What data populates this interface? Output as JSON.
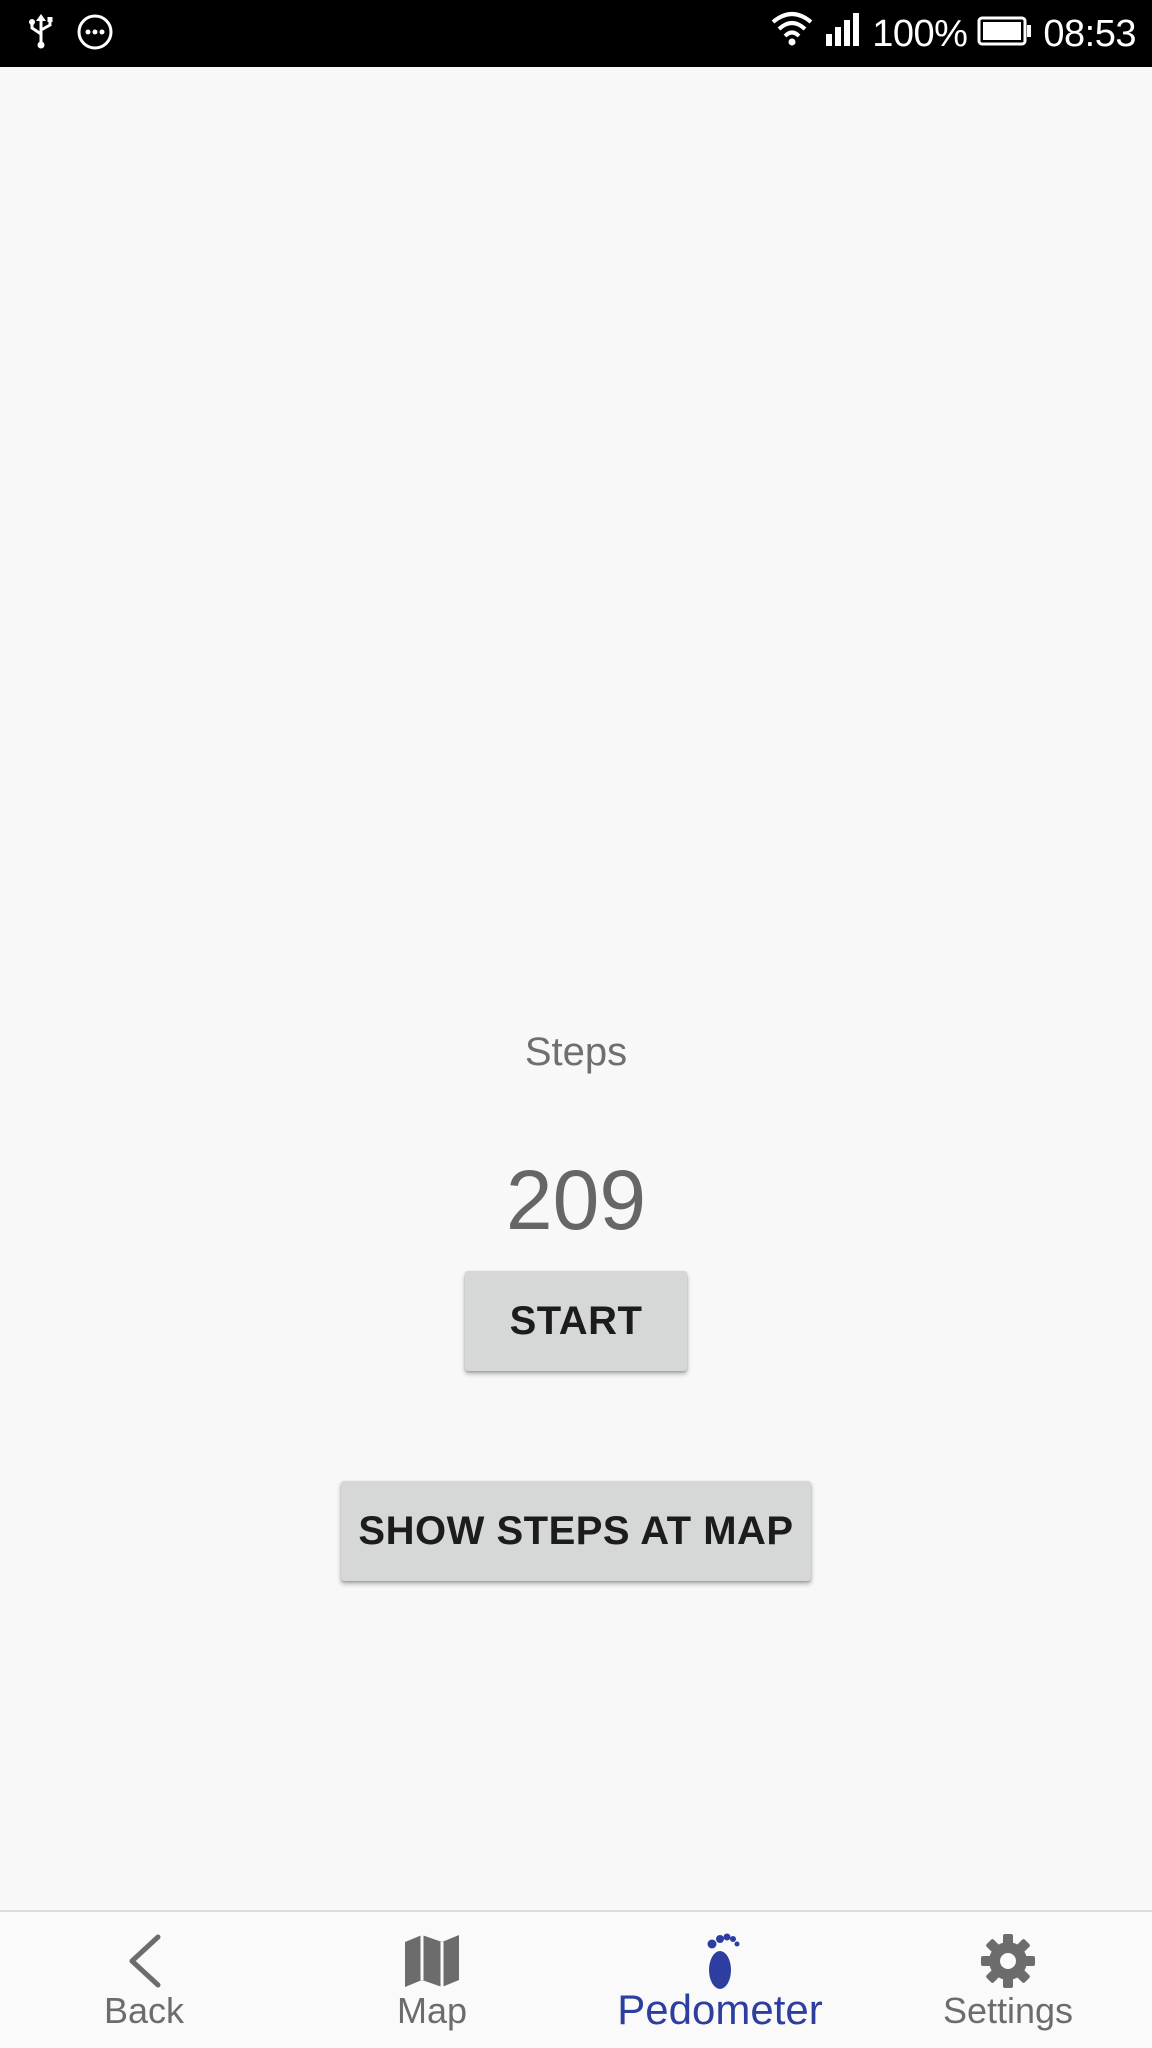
{
  "status_bar": {
    "battery": "100%",
    "time": "08:53",
    "icons": [
      "usb-icon",
      "more-icon",
      "wifi-icon",
      "signal-icon",
      "battery-icon"
    ]
  },
  "main": {
    "steps_label": "Steps",
    "steps_value": "209",
    "start_button": "START",
    "show_map_button": "SHOW STEPS AT MAP"
  },
  "bottom_nav": {
    "items": [
      {
        "label": "Back",
        "icon": "chevron-left-icon"
      },
      {
        "label": "Map",
        "icon": "map-icon"
      },
      {
        "label": "Pedometer",
        "icon": "footprint-icon",
        "active": true
      },
      {
        "label": "Settings",
        "icon": "gear-icon"
      }
    ]
  },
  "colors": {
    "background": "#f8f8f8",
    "status_bar": "#000000",
    "button": "#d6d7d7",
    "active_nav": "#2d3ea0",
    "inactive_nav": "#6c6c6c"
  }
}
